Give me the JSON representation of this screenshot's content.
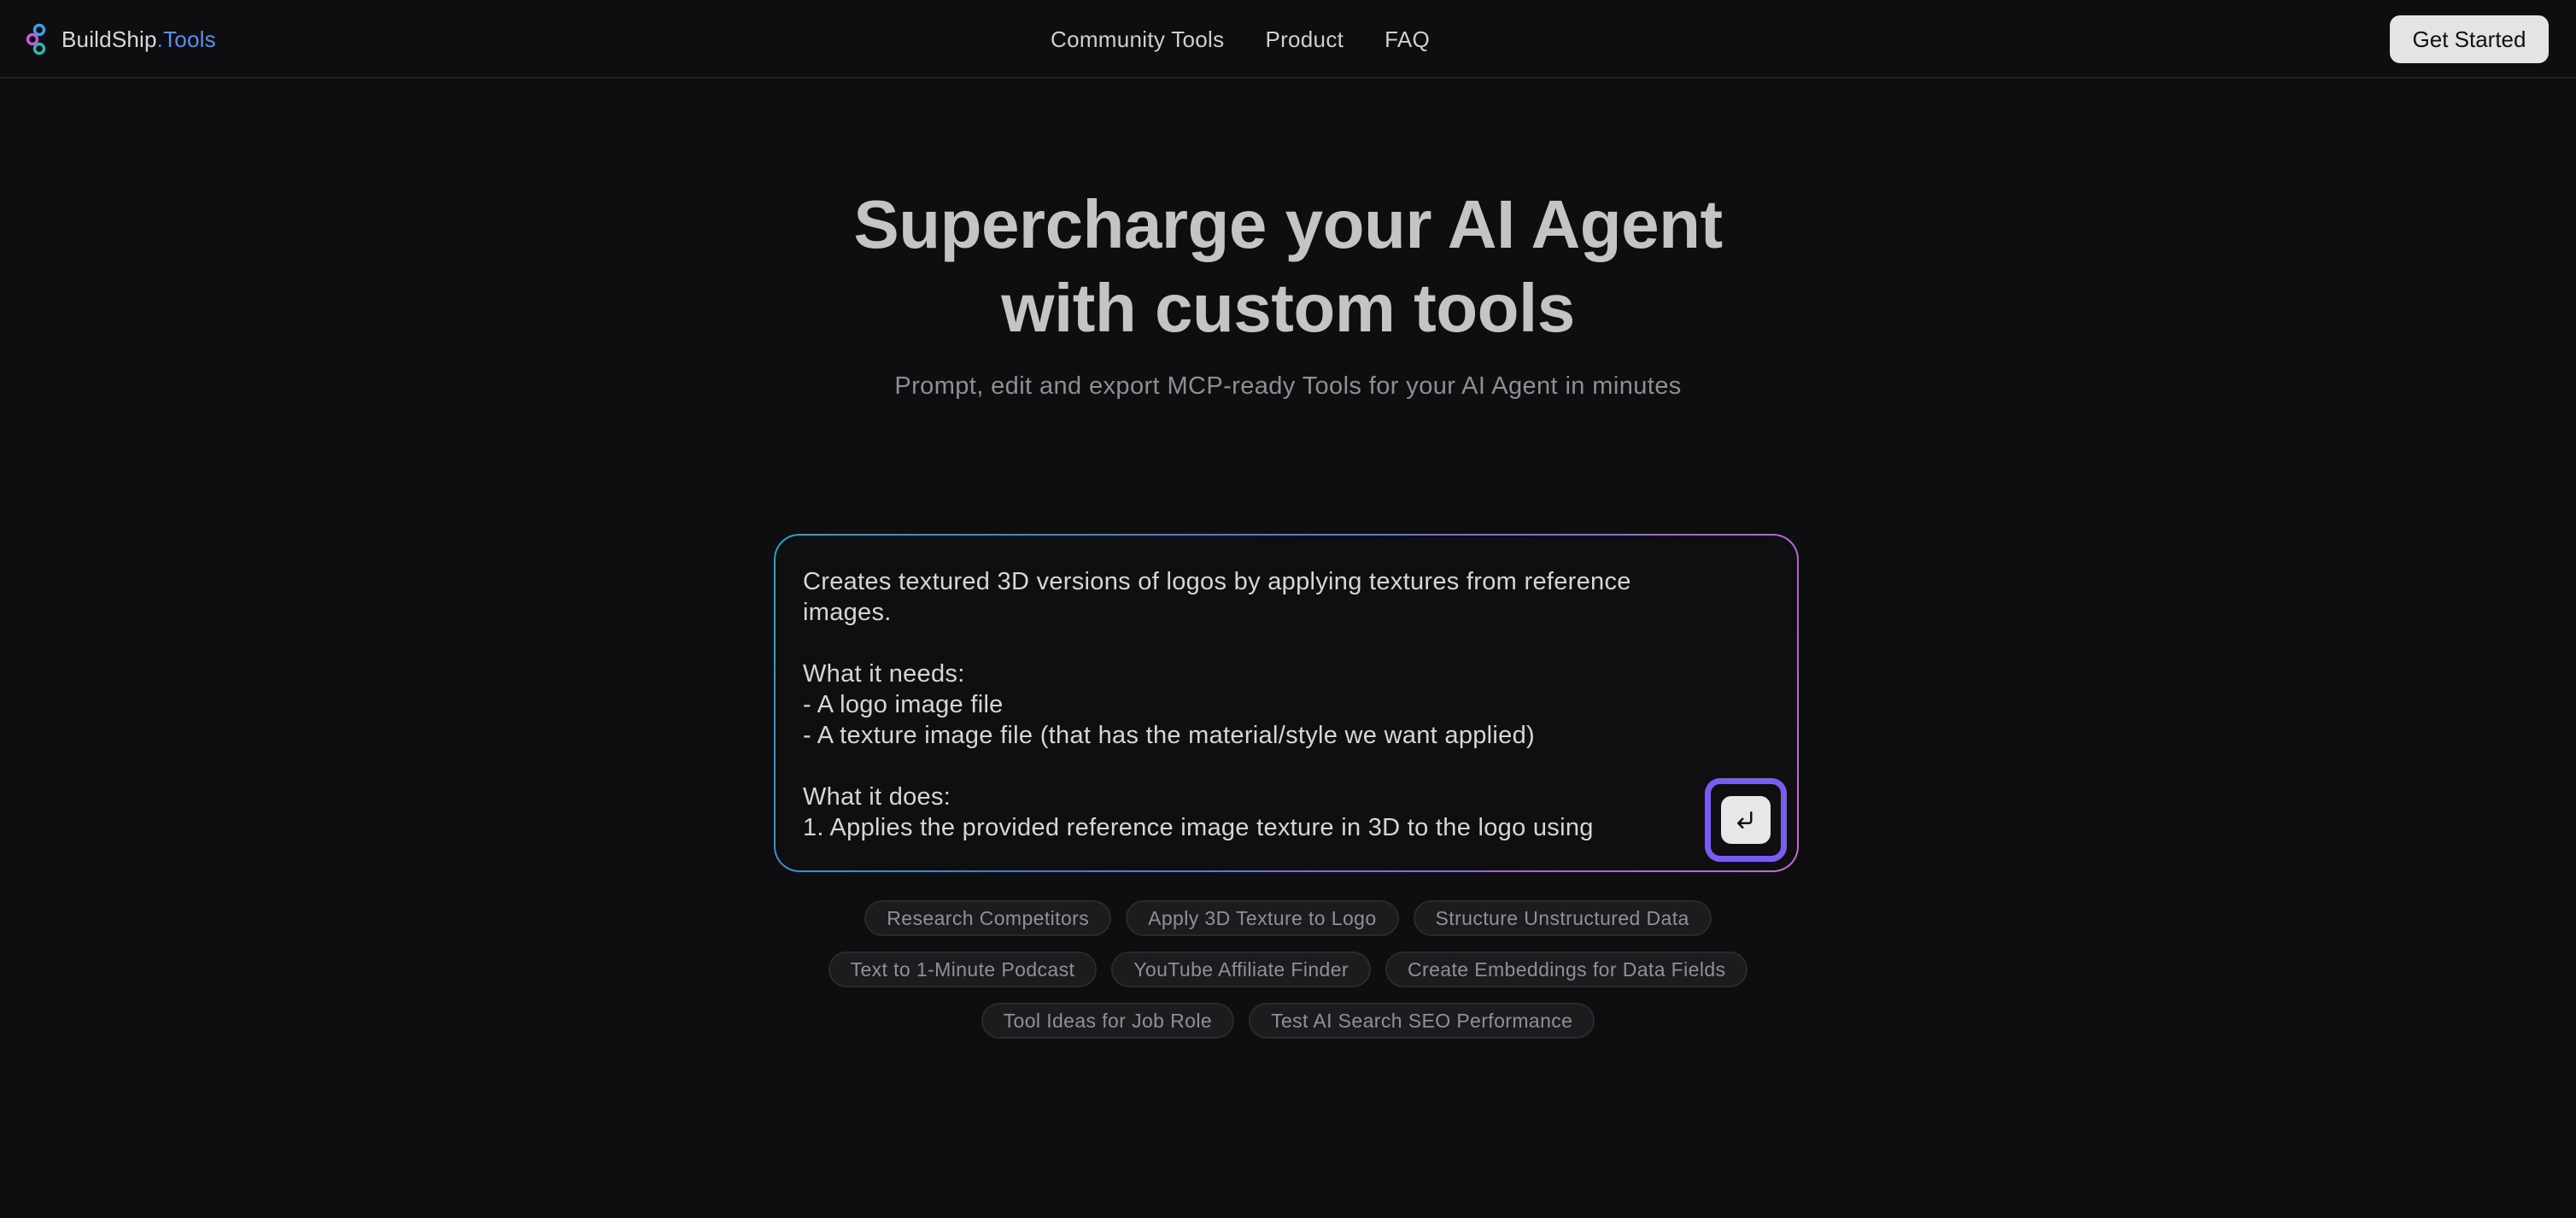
{
  "header": {
    "brand_name": "BuildShip",
    "brand_tld": ".Tools",
    "nav": [
      "Community Tools",
      "Product",
      "FAQ"
    ],
    "cta_label": "Get Started"
  },
  "hero": {
    "title_line1": "Supercharge your AI Agent",
    "title_line2": "with custom tools",
    "subtitle": "Prompt, edit and export MCP-ready Tools for your AI Agent in minutes"
  },
  "prompt": {
    "text": "Creates textured 3D versions of logos by applying textures from reference images.\n\nWhat it needs:\n- A logo image file\n- A texture image file (that has the material/style we want applied)\n\nWhat it does:\n1. Applies the provided reference image texture in 3D to the logo using",
    "submit_icon": "enter-return-icon"
  },
  "suggestions": {
    "row1": [
      "Research Competitors",
      "Apply 3D Texture to Logo",
      "Structure Unstructured Data"
    ],
    "row2": [
      "Text to 1-Minute Podcast",
      "YouTube Affiliate Finder",
      "Create Embeddings for Data Fields"
    ],
    "row3": [
      "Tool Ideas for Job Role",
      "Test AI Search SEO Performance"
    ]
  },
  "colors": {
    "background": "#0e0e10",
    "brand_accent": "#5c8df2",
    "focus_ring": "#7b5cf0"
  }
}
